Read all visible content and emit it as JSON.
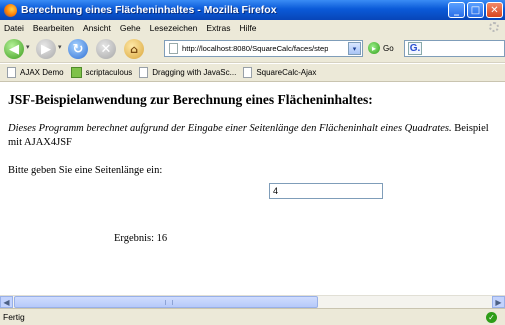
{
  "window": {
    "title": "Berechnung eines Flächeninhaltes - Mozilla Firefox",
    "minimize": "_",
    "maximize": "□",
    "close": "✕"
  },
  "menu": [
    "Datei",
    "Bearbeiten",
    "Ansicht",
    "Gehe",
    "Lesezeichen",
    "Extras",
    "Hilfe"
  ],
  "toolbar": {
    "url": "http://localhost:8080/SquareCalc/faces/step",
    "go_label": "Go",
    "search_engine": "G."
  },
  "bookmarks": [
    "AJAX Demo",
    "scriptaculous",
    "Dragging with JavaSc...",
    "SquareCalc-Ajax"
  ],
  "page": {
    "heading": "JSF-Beispielanwendung zur Berechnung eines Flächeninhaltes:",
    "intro_italic": "Dieses Programm berechnet aufgrund der Eingabe einer Seitenlänge den Flächeninhalt eines Quadrates.",
    "intro_rest": " Beispiel mit AJAX4JSF",
    "prompt": "Bitte geben Sie eine Seitenlänge ein:",
    "input_value": "4",
    "result": "Ergebnis: 16"
  },
  "status": {
    "text": "Fertig"
  },
  "colors": {
    "titlebar": "#0a5ad8",
    "chrome": "#ece9d8"
  }
}
